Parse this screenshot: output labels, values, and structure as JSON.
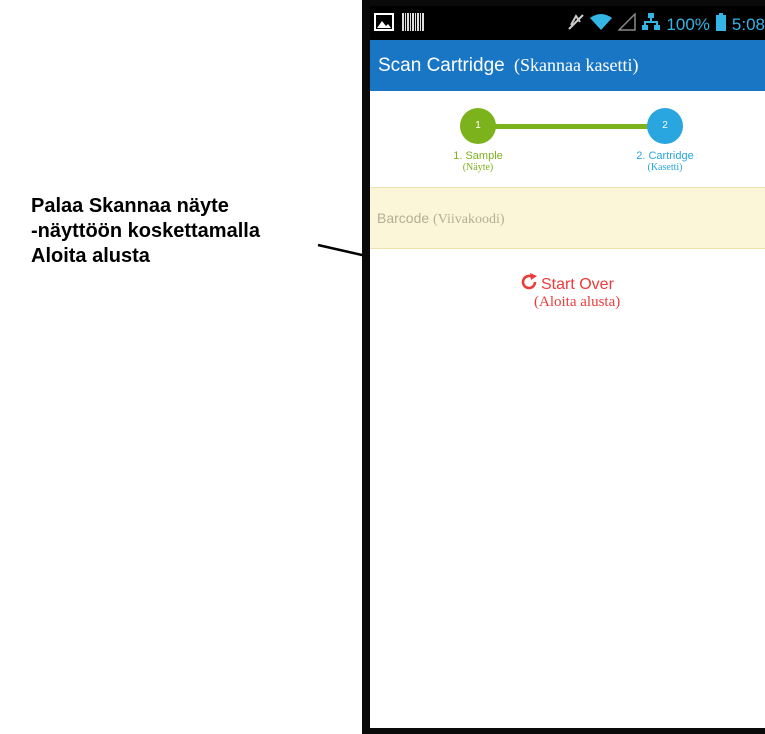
{
  "callout": {
    "line1": "Palaa Skannaa näyte",
    "line2": "-näyttöön koskettamalla",
    "line3": "Aloita alusta"
  },
  "status_bar": {
    "battery": "100%",
    "time": "5:08",
    "icons": [
      "image-icon",
      "barcode-icon",
      "mute-icon",
      "wifi-icon",
      "signal-icon",
      "network-icon",
      "battery-icon"
    ]
  },
  "app_bar": {
    "title": "Scan Cartridge",
    "title_translation": "(Skannaa kasetti)"
  },
  "stepper": {
    "steps": [
      {
        "number": "1",
        "label": "1. Sample",
        "translation": "(Näyte)",
        "color": "#7cb21c"
      },
      {
        "number": "2",
        "label": "2. Cartridge",
        "translation": "(Kasetti)",
        "color": "#29a6df"
      }
    ]
  },
  "barcode": {
    "placeholder": "Barcode",
    "translation": "(Viivakoodi)"
  },
  "start_over": {
    "label": "Start Over",
    "translation": "(Aloita alusta)",
    "color": "#ec3b3b"
  },
  "colors": {
    "app_bar": "#1976c5",
    "barcode_bg": "#fbf6d7"
  }
}
